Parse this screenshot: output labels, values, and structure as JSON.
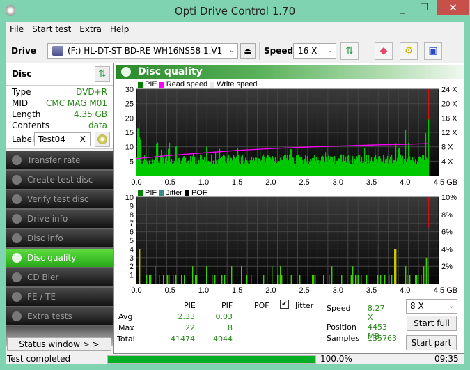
{
  "window": {
    "title": "Opti Drive Control 1.70",
    "minimize": "_",
    "maximize": "☐",
    "close": "✕"
  },
  "menu": [
    "File",
    "Start test",
    "Extra",
    "Help"
  ],
  "toolbar": {
    "drive_label": "Drive",
    "drive_value": "(F:)  HL-DT-ST BD-RE  WH16NS58 1.V1",
    "speed_label": "Speed",
    "speed_value": "16 X"
  },
  "disc": {
    "title": "Disc",
    "type_label": "Type",
    "type": "DVD+R",
    "mid_label": "MID",
    "mid": "CMC MAG M01",
    "length_label": "Length",
    "length": "4.35 GB",
    "contents_label": "Contents",
    "contents": "data",
    "label_label": "Label",
    "label_value": "Test04",
    "label_clear": "X"
  },
  "nav": [
    {
      "label": "Transfer rate",
      "active": false
    },
    {
      "label": "Create test disc",
      "active": false
    },
    {
      "label": "Verify test disc",
      "active": false
    },
    {
      "label": "Drive info",
      "active": false
    },
    {
      "label": "Disc info",
      "active": false
    },
    {
      "label": "Disc quality",
      "active": true
    },
    {
      "label": "CD Bler",
      "active": false
    },
    {
      "label": "FE / TE",
      "active": false
    },
    {
      "label": "Extra tests",
      "active": false
    }
  ],
  "status_window_label": "Status window > >",
  "panel_title": "Disc quality",
  "chart_data": [
    {
      "type": "bar",
      "title": "PIE",
      "legend": [
        "PIE",
        "Read speed",
        "Write speed"
      ],
      "colors": {
        "PIE": "#00c000",
        "Read speed": "#ff00ff",
        "Write speed": "#e8e8e8"
      },
      "xlabel": "GB",
      "x_ticks": [
        "0.0",
        "0.5",
        "1.0",
        "1.5",
        "2.0",
        "2.5",
        "3.0",
        "3.5",
        "4.0",
        "4.5 GB"
      ],
      "xlim": [
        0,
        4.5
      ],
      "y_ticks": [
        5,
        10,
        15,
        20,
        25,
        30
      ],
      "ylim": [
        0,
        30
      ],
      "y2_ticks": [
        "4 X",
        "8 X",
        "12 X",
        "16 X",
        "20 X",
        "24 X"
      ],
      "y2lim": [
        0,
        24
      ],
      "pie_baseline": 7,
      "pie_peaks": [
        [
          0.02,
          19
        ],
        [
          0.04,
          14
        ],
        [
          0.06,
          12
        ],
        [
          0.3,
          12
        ],
        [
          0.48,
          12
        ],
        [
          0.58,
          11
        ],
        [
          1.5,
          10
        ],
        [
          2.3,
          10
        ],
        [
          3.85,
          12
        ],
        [
          3.9,
          10
        ],
        [
          4.0,
          17
        ],
        [
          4.05,
          12
        ],
        [
          4.3,
          17
        ],
        [
          4.35,
          22
        ]
      ],
      "read_speed": [
        [
          0,
          4.7
        ],
        [
          0.5,
          5.6
        ],
        [
          1.0,
          6.3
        ],
        [
          1.5,
          7.0
        ],
        [
          2.0,
          7.5
        ],
        [
          2.5,
          7.9
        ],
        [
          3.0,
          8.2
        ],
        [
          3.5,
          8.5
        ],
        [
          4.0,
          8.7
        ],
        [
          4.35,
          8.9
        ]
      ],
      "end_marker": 4.35
    },
    {
      "type": "bar",
      "title": "PIF",
      "legend": [
        "PIF",
        "Jitter",
        "POF"
      ],
      "colors": {
        "PIF": "#00c000",
        "Jitter": "#3a8a8a",
        "POF": "#000000"
      },
      "x_ticks": [
        "0.0",
        "0.5",
        "1.0",
        "1.5",
        "2.0",
        "2.5",
        "3.0",
        "3.5",
        "4.0",
        "4.5 GB"
      ],
      "xlim": [
        0,
        4.5
      ],
      "y_ticks": [
        1,
        2,
        3,
        4,
        5,
        6,
        7,
        8,
        9,
        10
      ],
      "ylim": [
        0,
        10
      ],
      "y2_ticks": [
        "2%",
        "4%",
        "6%",
        "8%",
        "10%"
      ],
      "pif_peaks": [
        [
          0.03,
          4
        ],
        [
          0.3,
          2
        ],
        [
          1.05,
          2
        ],
        [
          2.0,
          2
        ],
        [
          3.85,
          4
        ],
        [
          4.0,
          2
        ],
        [
          4.3,
          3
        ],
        [
          4.35,
          8
        ]
      ],
      "end_marker": 4.35
    }
  ],
  "stats": {
    "col_pie": "PIE",
    "col_pif": "PIF",
    "col_pof": "POF",
    "jitter_label": "Jitter",
    "jitter_checked": true,
    "rows": [
      {
        "label": "Avg",
        "pie": "2.33",
        "pif": "0.03"
      },
      {
        "label": "Max",
        "pie": "22",
        "pif": "8"
      },
      {
        "label": "Total",
        "pie": "41474",
        "pif": "4044"
      }
    ],
    "speed_label": "Speed",
    "speed": "8.27 X",
    "position_label": "Position",
    "position": "4453 MB",
    "samples_label": "Samples",
    "samples": "135763",
    "speed_select": "8 X",
    "start_full": "Start full",
    "start_part": "Start part"
  },
  "statusbar": {
    "text": "Test completed",
    "progress_pct": 100,
    "progress_text": "100.0%",
    "time": "09:35"
  }
}
